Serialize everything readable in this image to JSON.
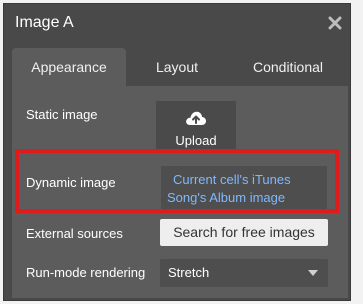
{
  "panel": {
    "title": "Image A",
    "close_icon": "close-icon"
  },
  "tabs": [
    {
      "label": "Appearance",
      "active": true
    },
    {
      "label": "Layout",
      "active": false
    },
    {
      "label": "Conditional",
      "active": false
    }
  ],
  "fields": {
    "static_image": {
      "label": "Static image",
      "button_label": "Upload",
      "icon": "upload-cloud-icon"
    },
    "dynamic_image": {
      "label": "Dynamic image",
      "value_line1": "Current cell's iTunes",
      "value_line2": "Song's Album image"
    },
    "external_sources": {
      "label": "External sources",
      "button_label": "Search for free images"
    },
    "run_mode_rendering": {
      "label": "Run-mode rendering",
      "selected": "Stretch"
    }
  },
  "colors": {
    "panel_bg": "#494949",
    "content_bg": "#5c5c5c",
    "link_blue": "#7fb8ff",
    "highlight_red": "#e01b1b"
  }
}
